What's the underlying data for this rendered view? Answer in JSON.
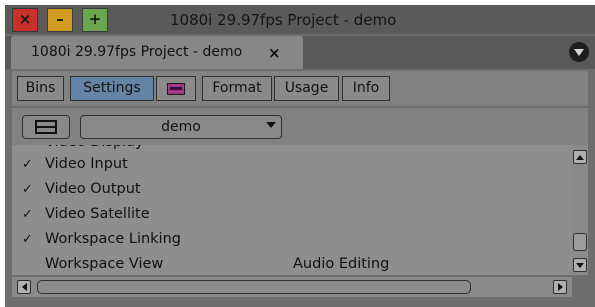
{
  "window": {
    "title": "1080i 29.97fps Project - demo",
    "close_label": "×",
    "minimize_label": "–",
    "zoom_label": "+"
  },
  "tab": {
    "label": "1080i 29.97fps Project - demo",
    "close_label": "×"
  },
  "toolbar": {
    "tabs": [
      {
        "label": "Bins",
        "active": false
      },
      {
        "label": "Settings",
        "active": true
      },
      {
        "label": "",
        "icon": "color-swatch-icon",
        "active": false
      },
      {
        "label": "Format",
        "active": false
      },
      {
        "label": "Usage",
        "active": false
      },
      {
        "label": "Info",
        "active": false
      }
    ]
  },
  "selector": {
    "value": "demo"
  },
  "settings_list": {
    "rows": [
      {
        "checked": true,
        "name": "Video Input",
        "value": ""
      },
      {
        "checked": true,
        "name": "Video Output",
        "value": ""
      },
      {
        "checked": true,
        "name": "Video Satellite",
        "value": ""
      },
      {
        "checked": true,
        "name": "Workspace Linking",
        "value": ""
      },
      {
        "checked": false,
        "name": "Workspace View",
        "value": "Audio Editing"
      }
    ],
    "check_glyph": "✓"
  },
  "colors": {
    "close": "#c9302c",
    "minimize": "#d39b1f",
    "zoom": "#6aa84f",
    "active_tab": "#6483a5",
    "color_swatch": "#a23a8c"
  }
}
